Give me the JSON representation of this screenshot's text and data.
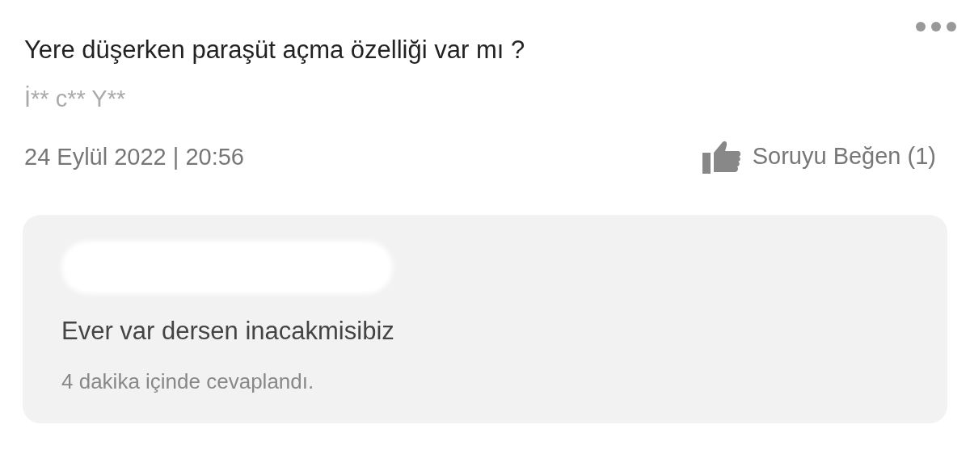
{
  "question": {
    "title": "Yere düşerken paraşüt açma özelliği var mı ?",
    "author": "İ** c** Y**",
    "date": "24 Eylül 2022 | 20:56",
    "like_label": "Soruyu Beğen (1)"
  },
  "answer": {
    "text": "Ever var dersen inacakmisibiz",
    "meta": "4 dakika içinde cevaplandı."
  }
}
